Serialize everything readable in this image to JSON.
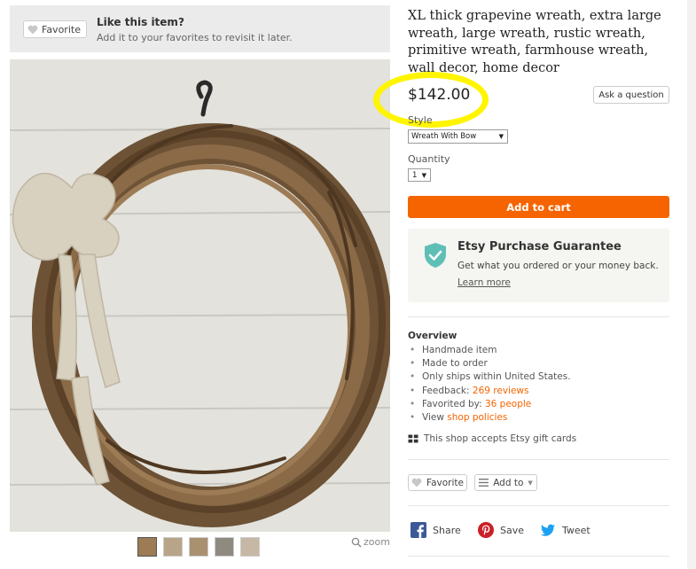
{
  "favorite_banner": {
    "button_label": "Favorite",
    "title": "Like this item?",
    "subtitle": "Add it to your favorites to revisit it later."
  },
  "gallery": {
    "zoom_label": "zoom",
    "thumbnail_count": 5
  },
  "product": {
    "title": "XL thick grapevine wreath, extra large wreath, large wreath, rustic wreath, primitive wreath, farmhouse wreath, wall decor, home decor",
    "price": "$142.00",
    "ask_question_label": "Ask a question",
    "style_label": "Style",
    "style_value": "Wreath With Bow",
    "quantity_label": "Quantity",
    "quantity_value": "1",
    "add_to_cart_label": "Add to cart"
  },
  "guarantee": {
    "title": "Etsy Purchase Guarantee",
    "text": "Get what you ordered or your money back.",
    "link": "Learn more"
  },
  "overview": {
    "heading": "Overview",
    "items": {
      "handmade": "Handmade item",
      "made_to_order": "Made to order",
      "ships": "Only ships within United States.",
      "feedback_label": "Feedback: ",
      "feedback_link": "269 reviews",
      "favorited_label": "Favorited by: ",
      "favorited_link": "36 people",
      "view_label": "View ",
      "view_link": "shop policies"
    },
    "gift_cards": "This shop accepts Etsy gift cards"
  },
  "actions": {
    "favorite_label": "Favorite",
    "add_to_label": "Add to"
  },
  "share": {
    "facebook_label": "Share",
    "pinterest_label": "Save",
    "twitter_label": "Tweet"
  },
  "colors": {
    "accent_orange": "#f56400",
    "guarantee_teal": "#5fbfb6",
    "annotation_yellow": "#fff500",
    "facebook_blue": "#3b5998",
    "pinterest_red": "#cb2027",
    "twitter_blue": "#1da1f2"
  }
}
